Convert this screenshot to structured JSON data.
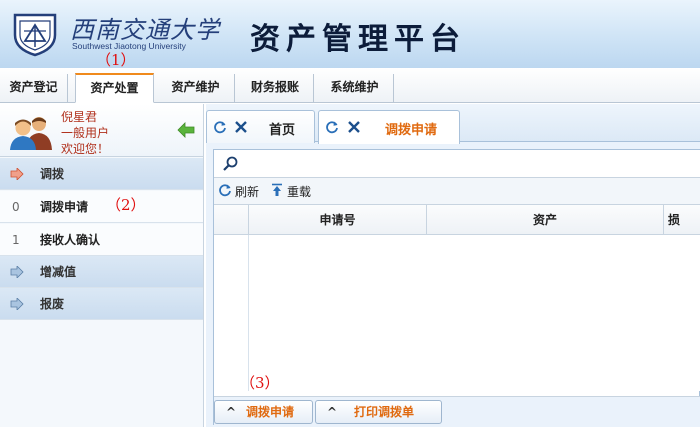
{
  "header": {
    "logo_cn": "西南交通大学",
    "logo_en": "Southwest Jiaotong University",
    "platform_title": "资产管理平台"
  },
  "annotations": [
    "（1）",
    "（2）",
    "（3）"
  ],
  "menu": {
    "items": [
      {
        "label": "资产登记"
      },
      {
        "label": "资产处置",
        "active": true
      },
      {
        "label": "资产维护"
      },
      {
        "label": "财务报账"
      },
      {
        "label": "系统维护"
      }
    ]
  },
  "user": {
    "name": "倪星君",
    "role": "一般用户",
    "welcome": "欢迎您！"
  },
  "sidebar": {
    "items": [
      {
        "label": "调拨",
        "type": "group",
        "open": true
      },
      {
        "num": "0",
        "label": "调拨申请",
        "type": "sub"
      },
      {
        "num": "1",
        "label": "接收人确认",
        "type": "sub"
      },
      {
        "label": "增减值",
        "type": "group"
      },
      {
        "label": "报废",
        "type": "group"
      }
    ]
  },
  "tabs": [
    {
      "label": "首页"
    },
    {
      "label": "调拨申请",
      "active": true
    }
  ],
  "toolbar": {
    "refresh_label": "刷新",
    "reload_label": "重载"
  },
  "table": {
    "columns": [
      "申请号",
      "资产",
      "损"
    ]
  },
  "bottom_buttons": {
    "apply_label": "调拨申请",
    "print_label": "打印调拨单"
  },
  "colors": {
    "accent_orange": "#e06a10",
    "annotation_red": "#e01010",
    "header_blue": "#cfe4f6"
  }
}
